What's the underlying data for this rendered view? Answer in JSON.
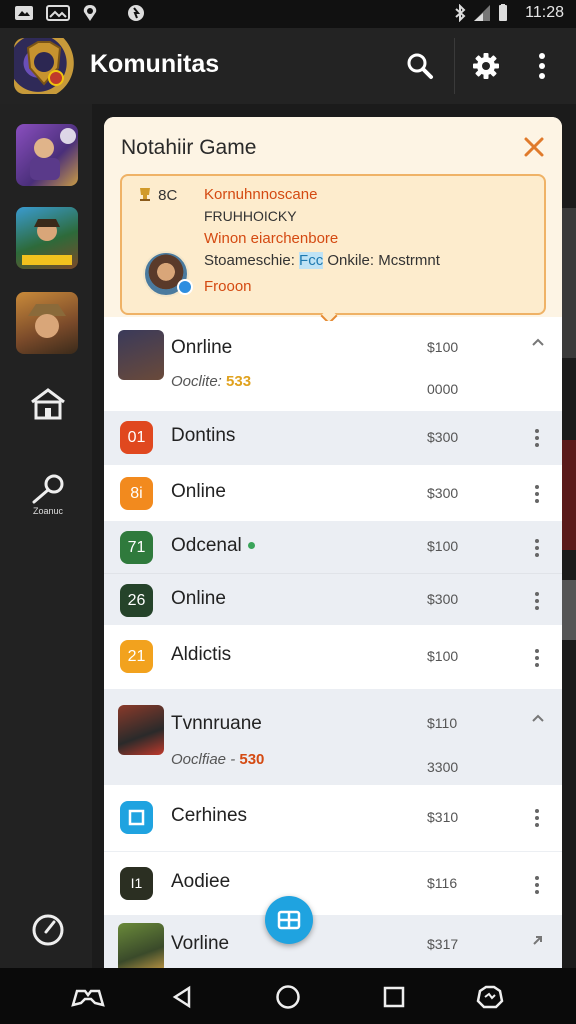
{
  "status_bar": {
    "time": "11:28"
  },
  "app_bar": {
    "title": "Komunitas"
  },
  "panel": {
    "title": "Notahiir Game",
    "notice": {
      "badge": "8C",
      "line1": "Kornuhnnoscane",
      "line2": "FRUHHOICKY",
      "line3": "Winon eiarchenbore",
      "line4_a": "Stoameschie: ",
      "line4_b": "Fcc",
      "line4_c": " Onkile: Mcstrmnt",
      "line5": "Frooon"
    },
    "groups": [
      {
        "label": "Onrline",
        "sub_prefix": "Ooclite: ",
        "sub_value": "533",
        "amount": "$100",
        "amount2": "0000"
      },
      {
        "label": "Tvnnruane",
        "sub_prefix": "Ooclfiae - ",
        "sub_value": "530",
        "amount": "$110",
        "amount2": "3300"
      },
      {
        "label": "Vorline",
        "amount": "$317"
      }
    ],
    "items": [
      {
        "badge": "01",
        "label": "Dontins",
        "amount": "$300"
      },
      {
        "badge": "8i",
        "label": "Online",
        "amount": "$300"
      },
      {
        "badge": "71",
        "label": "Odcenal",
        "amount": "$100"
      },
      {
        "badge": "26",
        "label": "Online",
        "amount": "$300"
      },
      {
        "badge": "21",
        "label": "Aldictis",
        "amount": "$100"
      },
      {
        "badge": "",
        "label": "Cerhines",
        "amount": "$310"
      },
      {
        "badge": "I1",
        "label": "Aodiee",
        "amount": "$116"
      }
    ]
  },
  "sidebar": {
    "tool_label": "Zoanuc"
  },
  "colors": {
    "accent_orange": "#e07a2b",
    "badge_red": "#e0481f",
    "badge_orange": "#f28a1e",
    "badge_green": "#2f7a3c",
    "badge_darkgreen": "#25432a",
    "badge_amber": "#f2a21e",
    "badge_blue": "#1fa3e0",
    "badge_dark": "#2b2f22",
    "fab_blue": "#1fa3e0"
  }
}
